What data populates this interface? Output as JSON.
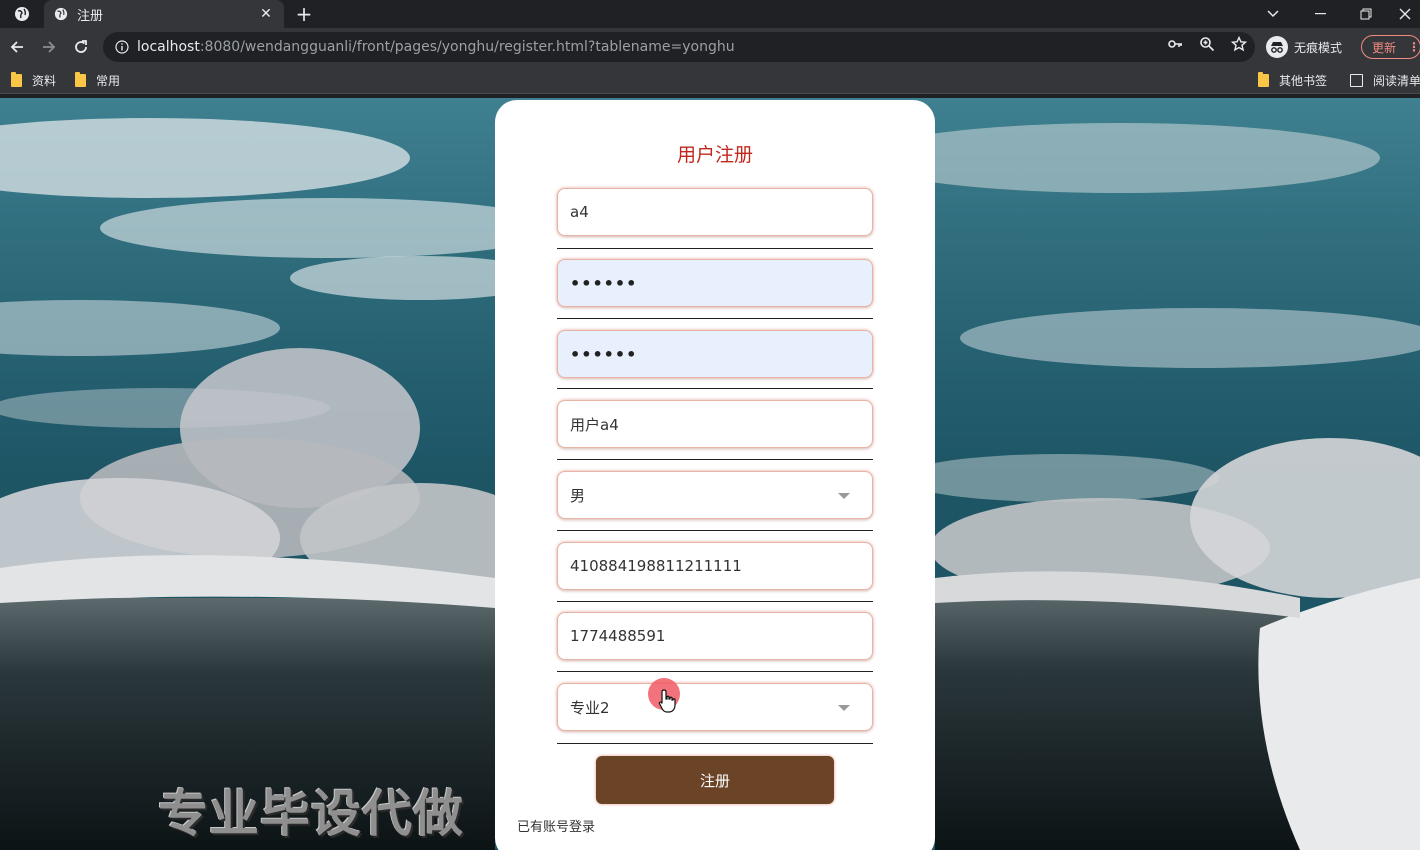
{
  "browser": {
    "tab_title": "注册",
    "url_host": "localhost",
    "url_rest": ":8080/wendangguanli/front/pages/yonghu/register.html?tablename=yonghu",
    "incognito_label": "无痕模式",
    "update_label": "更新",
    "bookmarks": [
      "资料",
      "常用"
    ],
    "other_bookmarks": "其他书签",
    "reading_list": "阅读清单"
  },
  "form": {
    "title": "用户注册",
    "account": "a4",
    "password": "••••••",
    "confirm_password": "••••••",
    "name": "用户a4",
    "gender": "男",
    "id_card": "410884198811211111",
    "phone": "1774488591",
    "major": "专业2",
    "submit_label": "注册",
    "login_link": "已有账号登录"
  },
  "watermark": "专业毕设代做",
  "colors": {
    "title": "#c0281e",
    "submit": "#6b4428",
    "autofill": "#e8f0fe"
  }
}
